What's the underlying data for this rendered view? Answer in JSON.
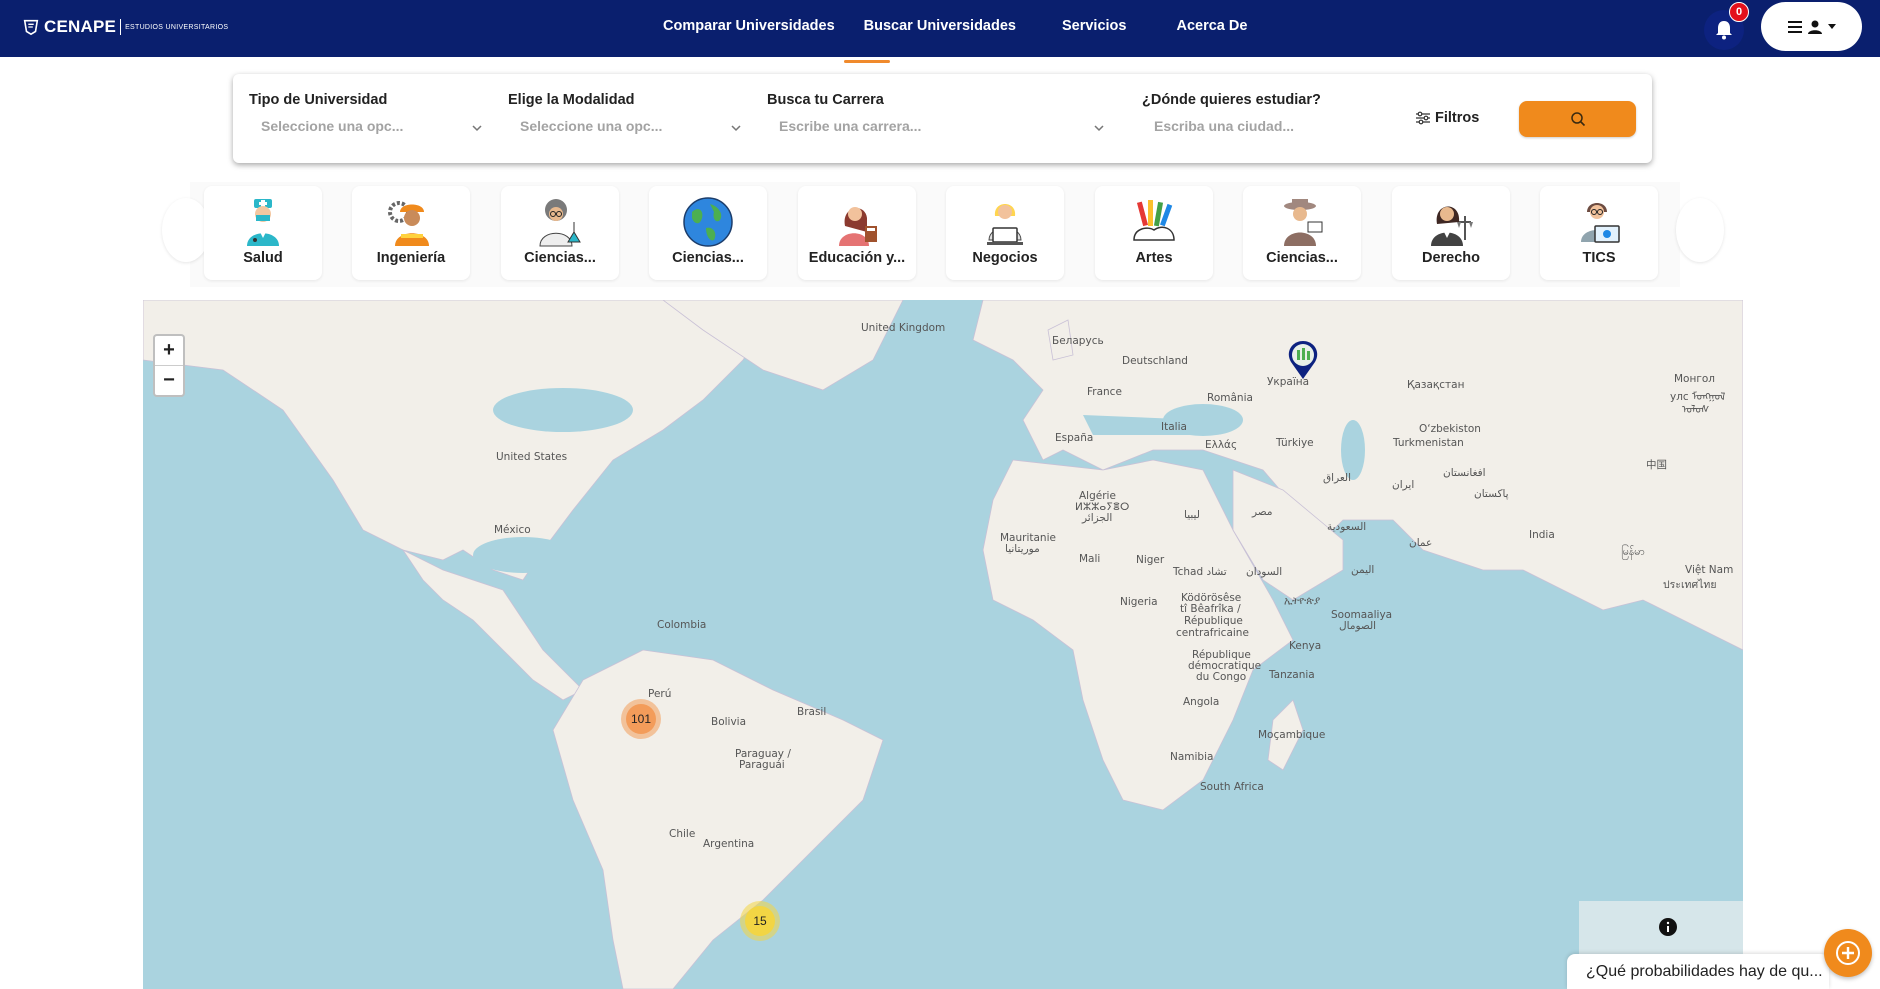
{
  "brand": {
    "name": "CENAPE",
    "subtitle": "ESTUDIOS UNIVERSITARIOS"
  },
  "nav": {
    "links": [
      "Comparar Universidades",
      "Buscar Universidades",
      "Servicios",
      "Acerca De"
    ],
    "notifications_count": "0",
    "colors": {
      "bar": "#0a1f6e",
      "accent": "#f08a2c",
      "badge": "#e3101b"
    }
  },
  "search": {
    "fields": [
      {
        "label": "Tipo de Universidad",
        "placeholder": "Seleccione una opc..."
      },
      {
        "label": "Elige la Modalidad",
        "placeholder": "Seleccione una opc..."
      },
      {
        "label": "Busca tu Carrera",
        "placeholder": "Escribe una carrera..."
      },
      {
        "label": "¿Dónde quieres estudiar?",
        "placeholder": "Escriba una ciudad..."
      }
    ],
    "filters_label": "Filtros",
    "search_icon": "search-icon"
  },
  "categories": [
    {
      "label": "Salud",
      "icon": "doctor-icon"
    },
    {
      "label": "Ingeniería",
      "icon": "engineer-icon"
    },
    {
      "label": "Ciencias...",
      "icon": "scientist-icon"
    },
    {
      "label": "Ciencias...",
      "icon": "globe-icon"
    },
    {
      "label": "Educación y...",
      "icon": "teacher-icon"
    },
    {
      "label": "Negocios",
      "icon": "business-laptop-icon"
    },
    {
      "label": "Artes",
      "icon": "art-supplies-icon"
    },
    {
      "label": "Ciencias...",
      "icon": "explorer-icon"
    },
    {
      "label": "Derecho",
      "icon": "lawyer-icon"
    },
    {
      "label": "TICS",
      "icon": "programmer-icon"
    }
  ],
  "map": {
    "zoom_in": "+",
    "zoom_out": "−",
    "labels": [
      "United Kingdom",
      "Беларусь",
      "Deutschland",
      "France",
      "Україна",
      "Қазақстан",
      "Монгол",
      "улс ᠮᠣᠩᠭᠣᠯ",
      "ᠤᠯᠤᠰ",
      "România",
      "España",
      "Italia",
      "Ελλάς",
      "Türkiye",
      "O‘zbekiston",
      "Turkmenistan",
      "United States",
      "Algérie",
      "ⵍⵣⵣⴰⵢⴻⵔ",
      "الجزائر",
      "ليبيا",
      "مصر",
      "العراق",
      "ایران",
      "افغانستان",
      "پاکستان",
      "中国",
      "México",
      "Mauritanie",
      "موريتانيا",
      "السعودية",
      "عمان",
      "India",
      "Mali",
      "Niger",
      "Tchad تشاد",
      "السودان",
      "اليمن",
      "မြန်မာ",
      "Việt Nam",
      "ประเทศไทย",
      "Nigeria",
      "Ködörösêse",
      "tî Bêafrîka /",
      "République",
      "centrafricaine",
      "ኢትዮጵያ",
      "Soomaaliya",
      "الصومال",
      "Colombia",
      "Kenya",
      "République",
      "démocratique",
      "du Congo",
      "Tanzania",
      "Perú",
      "Brasil",
      "Angola",
      "Bolivia",
      "Moçambique",
      "Paraguay /",
      "Paraguái",
      "Namibia",
      "South Africa",
      "Chile",
      "Argentina"
    ],
    "clusters": [
      {
        "count": "101",
        "color": "#f39c5a"
      },
      {
        "count": "15",
        "color": "#f2d544"
      }
    ],
    "colors": {
      "water": "#aad3df",
      "land": "#f2efe9"
    }
  },
  "chat": {
    "prompt": "¿Qué probabilidades hay de qu..."
  }
}
